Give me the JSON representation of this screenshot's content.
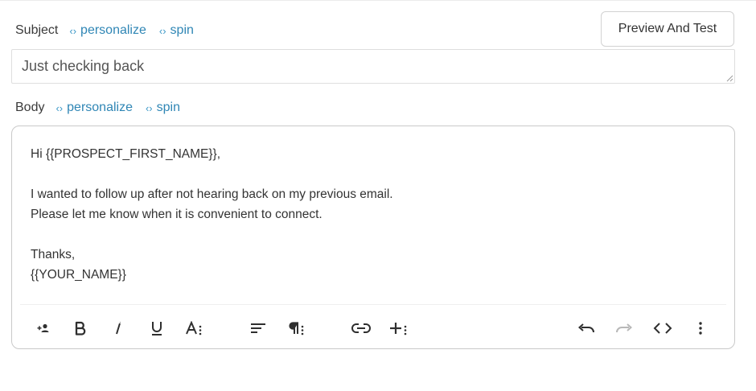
{
  "subject": {
    "label": "Subject",
    "personalize": "personalize",
    "spin": "spin",
    "value": "Just checking back"
  },
  "preview_button": "Preview And Test",
  "body": {
    "label": "Body",
    "personalize": "personalize",
    "spin": "spin",
    "lines": [
      "Hi {{PROSPECT_FIRST_NAME}},",
      "",
      "I wanted to follow up after not hearing back on my previous email.",
      "Please let me know when it is convenient to connect.",
      "",
      "Thanks,",
      "{{YOUR_NAME}}"
    ]
  },
  "toolbar": {
    "items": [
      "add-person-icon",
      "bold-icon",
      "italic-icon",
      "underline-icon",
      "font-size-icon",
      "align-icon",
      "paragraph-icon",
      "link-icon",
      "insert-icon",
      "undo-icon",
      "redo-icon",
      "code-view-icon",
      "more-icon"
    ],
    "disabled_color": "#b8b8b8",
    "icon_color": "#2f2f2f"
  },
  "colors": {
    "link": "#2f86b5",
    "border": "#c9c9c9"
  }
}
